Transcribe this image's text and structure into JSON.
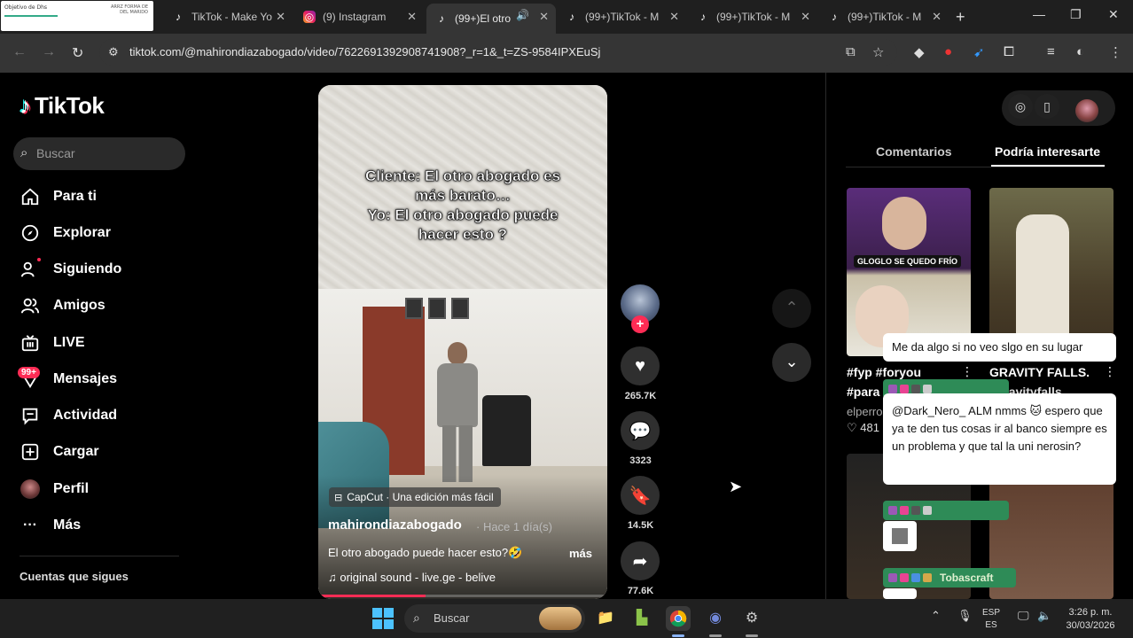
{
  "browser": {
    "tabs": [
      {
        "label": "TikTok - Make Yo",
        "icon": "tiktok-icon",
        "active": false
      },
      {
        "label": "(9) Instagram",
        "icon": "instagram-icon",
        "active": false
      },
      {
        "label": "(99+)El otro",
        "icon": "tiktok-icon",
        "active": true,
        "audio": true
      },
      {
        "label": "(99+)TikTok - M",
        "icon": "tiktok-icon",
        "active": false
      },
      {
        "label": "(99+)TikTok - M",
        "icon": "tiktok-icon",
        "active": false
      },
      {
        "label": "(99+)TikTok - M",
        "icon": "tiktok-icon",
        "active": false
      }
    ],
    "thumb_tab": {
      "text1": "Objetivo de Dhs",
      "text2": "ARRZ FORMA DE\nDEL MARIDO"
    },
    "new_tab_symbol": "+",
    "url": "tiktok.com/@mahirondiazabogado/video/7622691392908741908?_r=1&_t=ZS-9584IPXEuSj"
  },
  "tiktok": {
    "logo_text": "TikTok",
    "search_placeholder": "Buscar",
    "nav": [
      {
        "label": "Para ti",
        "icon": "home-icon"
      },
      {
        "label": "Explorar",
        "icon": "compass-icon"
      },
      {
        "label": "Siguiendo",
        "icon": "following-icon"
      },
      {
        "label": "Amigos",
        "icon": "friends-icon"
      },
      {
        "label": "LIVE",
        "icon": "live-icon"
      },
      {
        "label": "Mensajes",
        "icon": "messages-icon"
      },
      {
        "label": "Actividad",
        "icon": "activity-icon"
      },
      {
        "label": "Cargar",
        "icon": "upload-icon"
      },
      {
        "label": "Perfil",
        "icon": "profile-avatar"
      },
      {
        "label": "Más",
        "icon": "more-icon"
      }
    ],
    "messages_badge": "99+",
    "following_section": "Cuentas que sigues"
  },
  "video": {
    "caption_overlay": "Cliente: El otro abogado es\nmás barato…\nYo: El otro abogado puede\nhacer esto ?",
    "capcut_label": "CapCut · Una edición más fácil",
    "author": "mahirondiazabogado",
    "time_ago": "· Hace 1 día(s)",
    "description": "El otro abogado puede hacer esto?🤣",
    "more_label": "más",
    "sound": "♫  original sound - live.ge - belive",
    "progress": 0.37
  },
  "actions": {
    "likes": "265.7K",
    "comments": "3323",
    "saves": "14.5K",
    "shares": "77.6K"
  },
  "right_panel": {
    "tab_comments": "Comentarios",
    "tab_suggest": "Podría interesarte",
    "suggestions": [
      {
        "title": "#fyp #foryou",
        "title2": "#para",
        "meta": "elperro",
        "likes": "♡ 481",
        "overlay": "GLOGLO SE QUEDO FRÍO"
      },
      {
        "title": "GRAVITY FALLS.",
        "title2": "#gravityfalls"
      }
    ]
  },
  "chat_overlay": {
    "messages": [
      {
        "text": "Me da algo si no veo slgo en su lugar"
      },
      {
        "text": "@Dark_Nero_ ALM nmms 🐱 espero que ya te den tus cosas ir al banco siempre es un problema y que tal la uni nerosin?"
      }
    ],
    "users": [
      "Tobascraft"
    ]
  },
  "taskbar": {
    "search_placeholder": "Buscar",
    "lang_top": "ESP",
    "lang_bottom": "ES",
    "time": "3:26 p. m.",
    "date": "30/03/2026"
  }
}
